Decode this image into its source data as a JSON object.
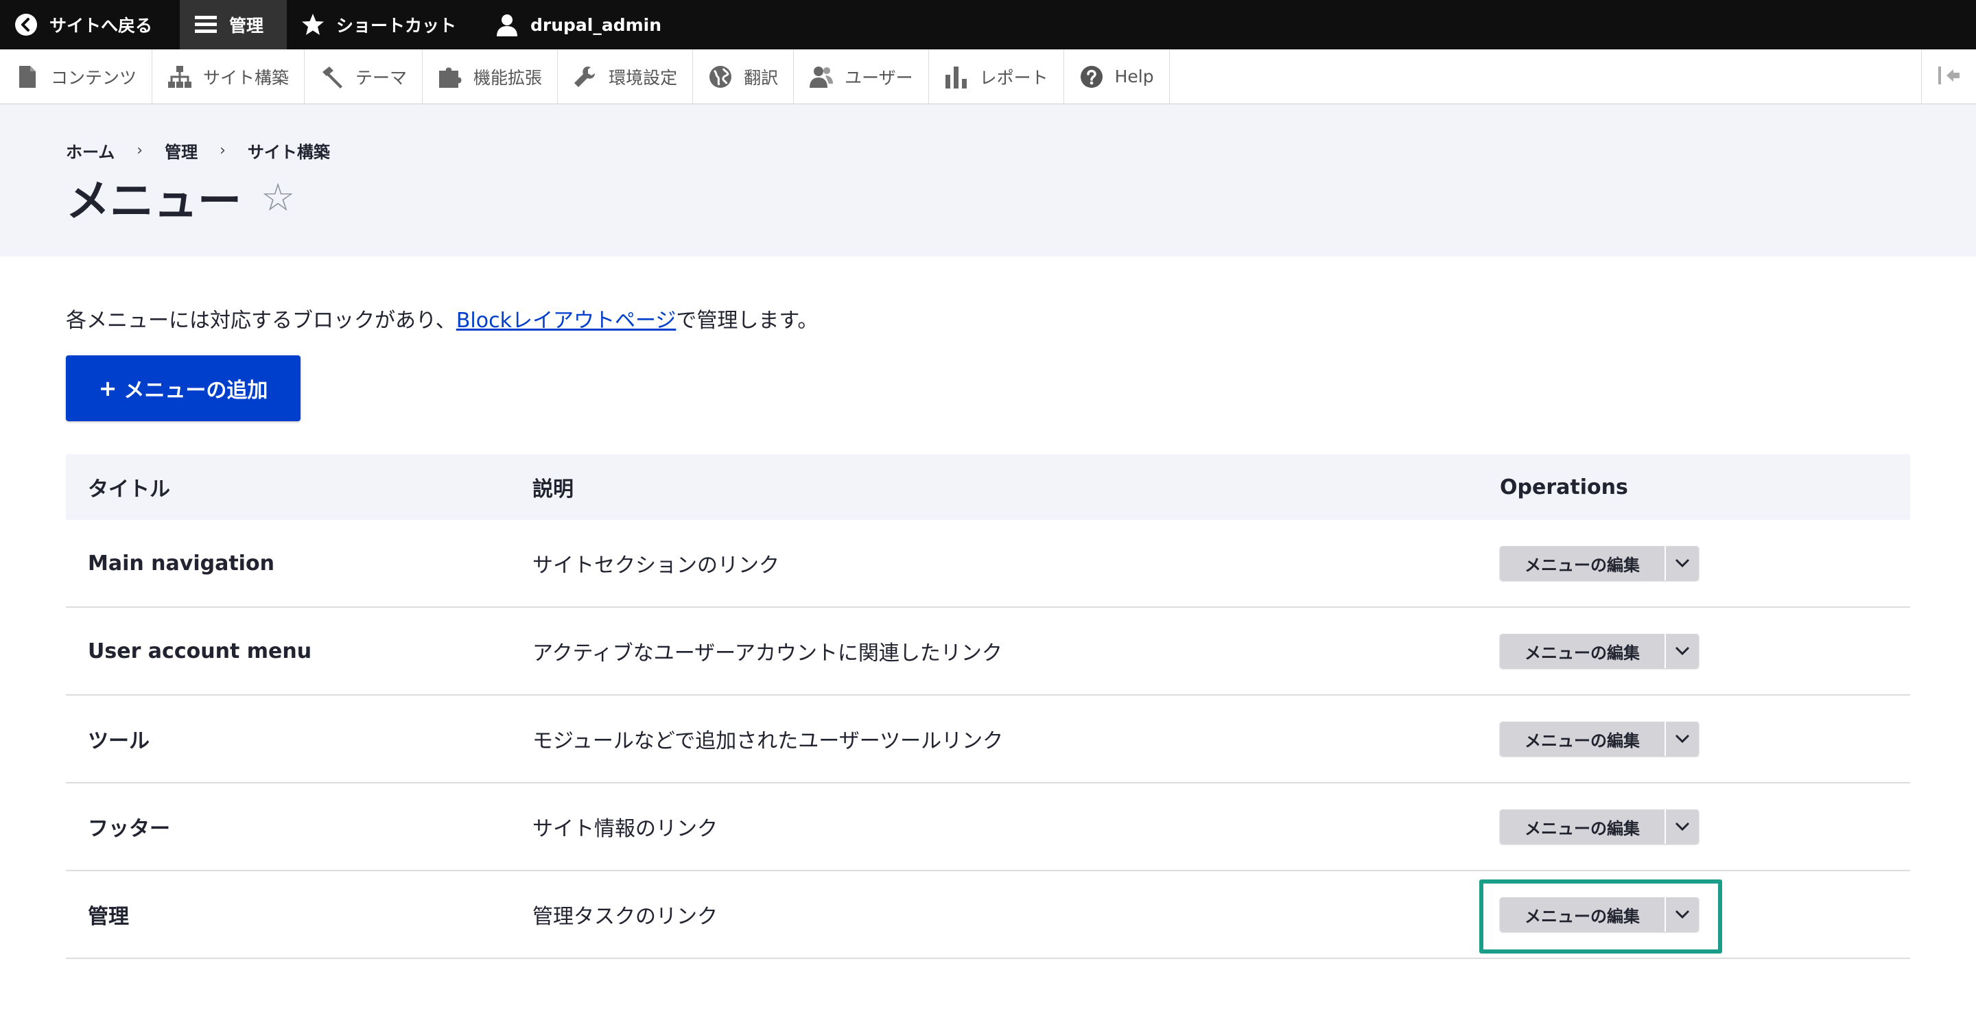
{
  "topbar": {
    "back_label": "サイトへ戻る",
    "manage_label": "管理",
    "shortcuts_label": "ショートカット",
    "user_label": "drupal_admin"
  },
  "tray": {
    "items": [
      {
        "label": "コンテンツ",
        "icon": "file-icon"
      },
      {
        "label": "サイト構築",
        "icon": "sitemap-icon"
      },
      {
        "label": "テーマ",
        "icon": "paintbrush-icon"
      },
      {
        "label": "機能拡張",
        "icon": "puzzle-icon"
      },
      {
        "label": "環境設定",
        "icon": "wrench-icon"
      },
      {
        "label": "翻訳",
        "icon": "globe-icon"
      },
      {
        "label": "ユーザー",
        "icon": "people-icon"
      },
      {
        "label": "レポート",
        "icon": "bar-chart-icon"
      },
      {
        "label": "Help",
        "icon": "help-icon"
      }
    ]
  },
  "breadcrumb": [
    "ホーム",
    "管理",
    "サイト構築"
  ],
  "page": {
    "title": "メニュー",
    "description_prefix": "各メニューには対応するブロックがあり、",
    "description_link": "Blockレイアウトページ",
    "description_suffix": "で管理します。",
    "add_button": "メニューの追加"
  },
  "table": {
    "headers": [
      "タイトル",
      "説明",
      "Operations"
    ],
    "rows": [
      {
        "title": "Main navigation",
        "description": "サイトセクションのリンク",
        "operation": "メニューの編集"
      },
      {
        "title": "User account menu",
        "description": "アクティブなユーザーアカウントに関連したリンク",
        "operation": "メニューの編集"
      },
      {
        "title": "ツール",
        "description": "モジュールなどで追加されたユーザーツールリンク",
        "operation": "メニューの編集"
      },
      {
        "title": "フッター",
        "description": "サイト情報のリンク",
        "operation": "メニューの編集"
      },
      {
        "title": "管理",
        "description": "管理タスクのリンク",
        "operation": "メニューの編集"
      }
    ]
  },
  "colors": {
    "accent": "#003ecc",
    "highlight": "#1a9e8a",
    "toolbar": "#0f0f0f"
  }
}
